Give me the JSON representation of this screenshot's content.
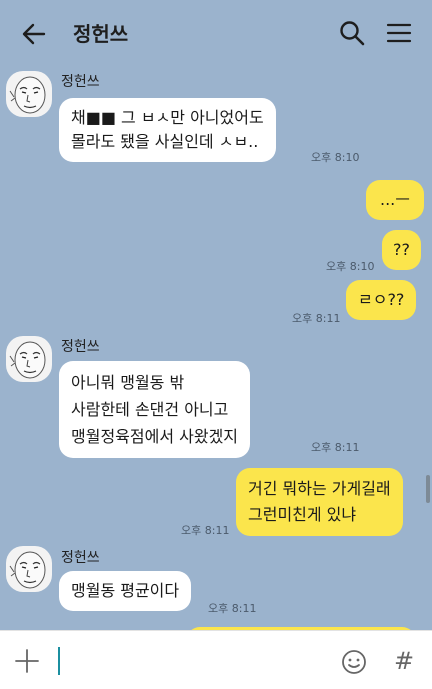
{
  "header": {
    "title": "정헌쓰",
    "back_icon": "arrow-left-icon",
    "search_icon": "search-icon",
    "menu_icon": "hamburger-menu-icon"
  },
  "messages": [
    {
      "type": "incoming",
      "sender": "정헌쓰",
      "lines": [
        "채■■ 그 ㅂㅅ만 아니었어도",
        "몰라도 됐을 사실인데 ㅅㅂ.."
      ],
      "time": "오후 8:10"
    },
    {
      "type": "outgoing",
      "lines": [
        "...ㅡ"
      ],
      "time": ""
    },
    {
      "type": "outgoing",
      "lines": [
        "??"
      ],
      "time": "오후 8:10"
    },
    {
      "type": "outgoing",
      "lines": [
        "ㄹㅇ??"
      ],
      "time": "오후 8:11"
    },
    {
      "type": "incoming",
      "sender": "정헌쓰",
      "lines": [
        "아니뭐 맹월동 밖",
        "사람한테 손댄건 아니고",
        "맹월정육점에서 사왔겠지"
      ],
      "time": "오후 8:11"
    },
    {
      "type": "outgoing",
      "lines": [
        "거긴 뭐하는 가게길래",
        "그런미친게 있냐"
      ],
      "time": "오후 8:11"
    },
    {
      "type": "incoming",
      "sender": "정헌쓰",
      "lines": [
        "맹월동 평균이다"
      ],
      "time": "오후 8:11"
    }
  ],
  "input": {
    "placeholder": "",
    "value": "",
    "plus_icon": "plus-icon",
    "emoji_icon": "emoji-icon",
    "hash_icon": "hash-icon",
    "hash_glyph": "#"
  },
  "colors": {
    "background": "#9bb3cd",
    "outgoing_bubble": "#fbe54c",
    "incoming_bubble": "#ffffff",
    "caret": "#1b8fa0"
  }
}
